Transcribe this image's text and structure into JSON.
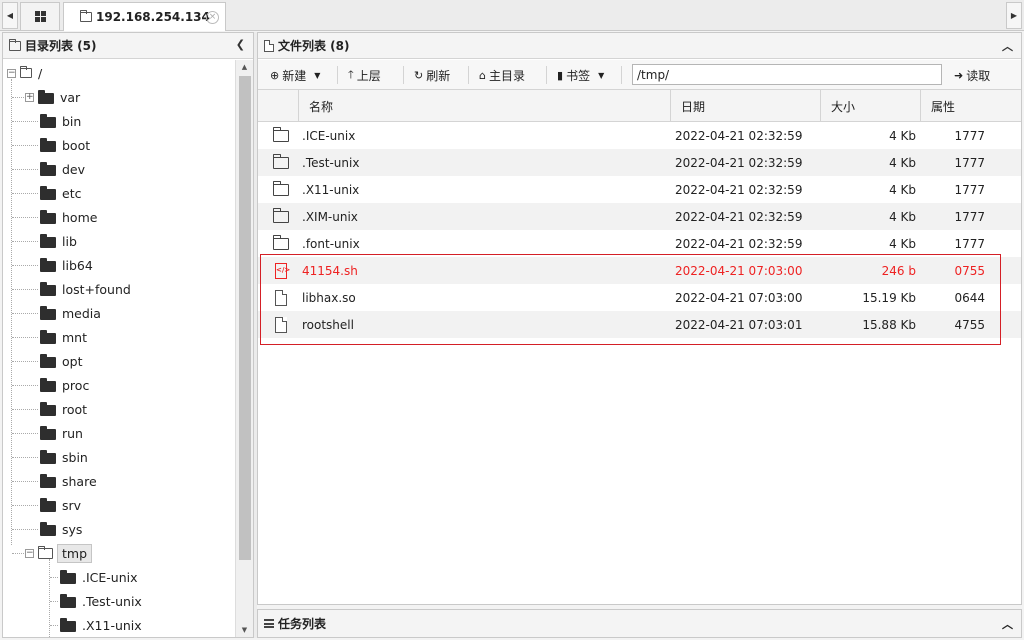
{
  "tabbar": {
    "tab_label": "192.168.254.134",
    "grid_icon": "grid-icon",
    "close_icon": "close-circle-icon"
  },
  "left_panel": {
    "title": "目录列表 (5)",
    "root_label": "/",
    "tree": [
      "var",
      "bin",
      "boot",
      "dev",
      "etc",
      "home",
      "lib",
      "lib64",
      "lost+found",
      "media",
      "mnt",
      "opt",
      "proc",
      "root",
      "run",
      "sbin",
      "share",
      "srv",
      "sys",
      "tmp"
    ],
    "selected": "tmp",
    "tmp_children": [
      ".ICE-unix",
      ".Test-unix",
      ".X11-unix"
    ]
  },
  "right_panel": {
    "title": "文件列表 (8)",
    "toolbar": {
      "new_label": "新建",
      "up_label": "上层",
      "refresh_label": "刷新",
      "home_label": "主目录",
      "bookmark_label": "书签",
      "path_value": "/tmp/",
      "read_label": "读取"
    },
    "columns": {
      "name": "名称",
      "date": "日期",
      "size": "大小",
      "attr": "属性"
    },
    "files": [
      {
        "name": ".ICE-unix",
        "date": "2022-04-21 02:32:59",
        "size": "4 Kb",
        "attr": "1777",
        "type": "folder"
      },
      {
        "name": ".Test-unix",
        "date": "2022-04-21 02:32:59",
        "size": "4 Kb",
        "attr": "1777",
        "type": "folder"
      },
      {
        "name": ".X11-unix",
        "date": "2022-04-21 02:32:59",
        "size": "4 Kb",
        "attr": "1777",
        "type": "folder"
      },
      {
        "name": ".XIM-unix",
        "date": "2022-04-21 02:32:59",
        "size": "4 Kb",
        "attr": "1777",
        "type": "folder"
      },
      {
        "name": ".font-unix",
        "date": "2022-04-21 02:32:59",
        "size": "4 Kb",
        "attr": "1777",
        "type": "folder"
      },
      {
        "name": "41154.sh",
        "date": "2022-04-21 07:03:00",
        "size": "246 b",
        "attr": "0755",
        "type": "code"
      },
      {
        "name": "libhax.so",
        "date": "2022-04-21 07:03:00",
        "size": "15.19 Kb",
        "attr": "0644",
        "type": "file"
      },
      {
        "name": "rootshell",
        "date": "2022-04-21 07:03:01",
        "size": "15.88 Kb",
        "attr": "4755",
        "type": "file"
      }
    ]
  },
  "task_panel": {
    "title": "任务列表"
  },
  "colors": {
    "highlight_red": "#d41f26",
    "modified_text": "#e22"
  }
}
